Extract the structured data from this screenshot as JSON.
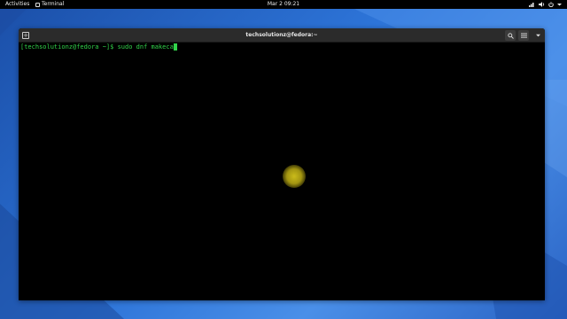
{
  "topbar": {
    "activities_label": "Activities",
    "app_label": "Terminal",
    "clock": "Mar 2  09:21",
    "status_icons": [
      "network-icon",
      "volume-icon",
      "power-icon"
    ]
  },
  "window": {
    "title": "techsolutionz@fedora:~",
    "buttons": {
      "new_tab_icon": "new-tab-icon",
      "search_icon": "search-icon",
      "menu_icon": "hamburger-menu-icon",
      "close_icon": "close-icon"
    }
  },
  "terminal": {
    "prompt": "[techsolutionz@fedora ~]$ ",
    "command": "sudo dnf makeca",
    "text_color": "#31d34a",
    "background_color": "#000000"
  },
  "colors": {
    "topbar": "#000000",
    "headerbar": "#2b2b2b",
    "desktop_accent": "#2d74d8",
    "pointer_highlight": "#d6c61c"
  }
}
